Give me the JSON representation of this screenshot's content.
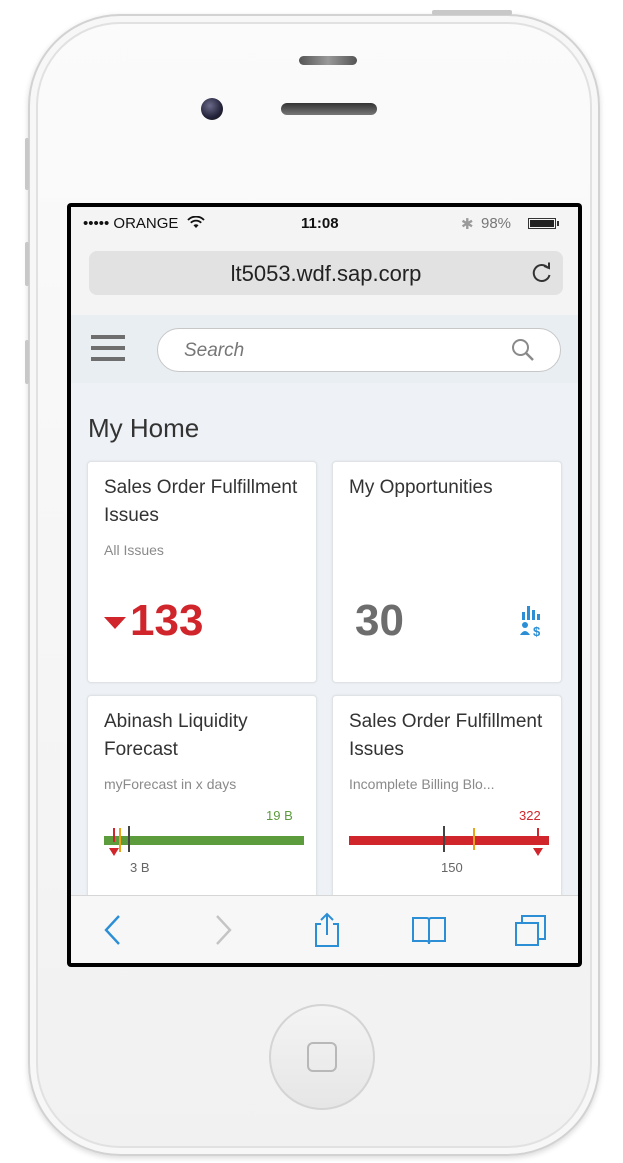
{
  "status_bar": {
    "carrier": "••••• ORANGE",
    "time": "11:08",
    "battery": "98%",
    "battery_level": 0.98
  },
  "browser": {
    "url": "lt5053.wdf.sap.corp",
    "load_progress": 0.68
  },
  "header": {
    "search_placeholder": "Search"
  },
  "page": {
    "title": "My Home"
  },
  "tiles": [
    {
      "title": "Sales Order Fulfillment Issues",
      "subtitle": "All Issues",
      "value": "133",
      "trend": "down",
      "value_color": "#d0252b"
    },
    {
      "title": "My Opportunities",
      "value": "30",
      "icon": "opportunities-icon"
    },
    {
      "title": "Abinash Liquidity Forecast",
      "subtitle": "myForecast in x days",
      "target_label": "19 B",
      "baseline_label": "3 B",
      "bar_color": "#5d9c3c"
    },
    {
      "title": "Sales Order Fulfillment Issues",
      "subtitle": "Incomplete Billing Blo...",
      "target_label": "322",
      "baseline_label": "150",
      "bar_color": "#d0252b"
    }
  ],
  "toolbar": {
    "icons": [
      "back-icon",
      "forward-icon",
      "share-icon",
      "bookmarks-icon",
      "tabs-icon"
    ]
  },
  "colors": {
    "accent": "#2c8fd6",
    "negative": "#d0252b",
    "positive": "#5d9c3c",
    "critical": "#e8a41a",
    "icon_blue": "#2c8fd6"
  }
}
